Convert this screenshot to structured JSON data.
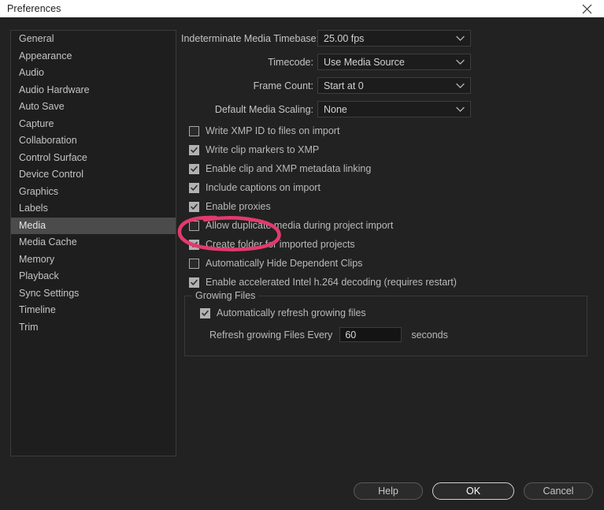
{
  "titlebar": {
    "title": "Preferences",
    "close_icon": "close-icon"
  },
  "sidebar": {
    "items": [
      {
        "label": "General",
        "selected": false
      },
      {
        "label": "Appearance",
        "selected": false
      },
      {
        "label": "Audio",
        "selected": false
      },
      {
        "label": "Audio Hardware",
        "selected": false
      },
      {
        "label": "Auto Save",
        "selected": false
      },
      {
        "label": "Capture",
        "selected": false
      },
      {
        "label": "Collaboration",
        "selected": false
      },
      {
        "label": "Control Surface",
        "selected": false
      },
      {
        "label": "Device Control",
        "selected": false
      },
      {
        "label": "Graphics",
        "selected": false
      },
      {
        "label": "Labels",
        "selected": false
      },
      {
        "label": "Media",
        "selected": true
      },
      {
        "label": "Media Cache",
        "selected": false
      },
      {
        "label": "Memory",
        "selected": false
      },
      {
        "label": "Playback",
        "selected": false
      },
      {
        "label": "Sync Settings",
        "selected": false
      },
      {
        "label": "Timeline",
        "selected": false
      },
      {
        "label": "Trim",
        "selected": false
      }
    ]
  },
  "main": {
    "dropdowns": [
      {
        "label": "Indeterminate Media Timebase:",
        "value": "25.00 fps",
        "icon": "chevron-down-icon"
      },
      {
        "label": "Timecode:",
        "value": "Use Media Source",
        "icon": "chevron-down-icon"
      },
      {
        "label": "Frame Count:",
        "value": "Start at 0",
        "icon": "chevron-down-icon"
      },
      {
        "label": "Default Media Scaling:",
        "value": "None",
        "icon": "chevron-down-icon"
      }
    ],
    "checkboxes": [
      {
        "label": "Write XMP ID to files on import",
        "checked": false
      },
      {
        "label": "Write clip markers to XMP",
        "checked": true
      },
      {
        "label": "Enable clip and XMP metadata linking",
        "checked": true
      },
      {
        "label": "Include captions on import",
        "checked": true
      },
      {
        "label": "Enable proxies",
        "checked": true,
        "annotated": true
      },
      {
        "label": "Allow duplicate media during project import",
        "checked": false
      },
      {
        "label": "Create folder for imported projects",
        "checked": true
      },
      {
        "label": "Automatically Hide Dependent Clips",
        "checked": false
      },
      {
        "label": "Enable accelerated Intel h.264 decoding (requires restart)",
        "checked": true
      }
    ],
    "growing_files": {
      "title": "Growing Files",
      "auto_refresh": {
        "label": "Automatically refresh growing files",
        "checked": true
      },
      "refresh_label": "Refresh growing Files Every",
      "refresh_value": "60",
      "unit_label": "seconds"
    }
  },
  "footer": {
    "help_label": "Help",
    "ok_label": "OK",
    "cancel_label": "Cancel"
  },
  "annotation": {
    "color": "#e23a6e",
    "target": "Enable proxies"
  }
}
